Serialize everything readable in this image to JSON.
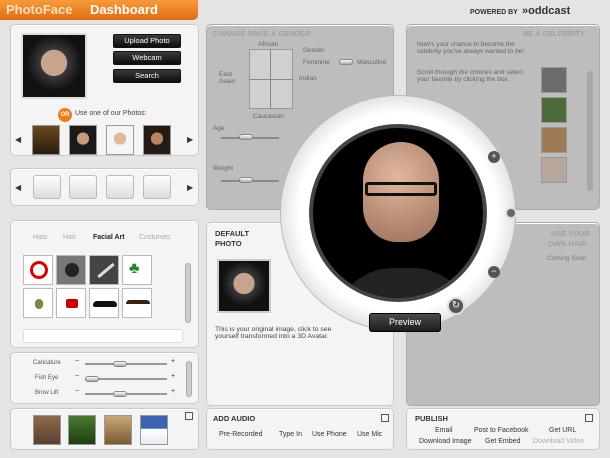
{
  "header": {
    "title_light": "PhotoFace",
    "title_bold": "Dashboard",
    "powered_by": "POWERED BY",
    "brand": "»oddcast"
  },
  "photo_panel": {
    "upload_label": "Upload Photo",
    "webcam_label": "Webcam",
    "search_label": "Search",
    "or_badge": "OR",
    "use_photos_label": "Use one of our Photos:"
  },
  "gender_panel": {
    "title": "CHANGE RACE & GENDER",
    "african": "African",
    "gender": "Gender",
    "east_asian": "East\nAsian",
    "feminine": "Feminine",
    "masculine": "Masculine",
    "indian": "Indian",
    "caucasian": "Caucasian",
    "age": "Age",
    "weight": "Weight"
  },
  "celebrity_panel": {
    "title": "BE A CELEBRITY",
    "text1": "Now's your chance to become the celebrity you've always wanted to be!",
    "text2": "Scroll through the choices and select your favorite by clicking the box."
  },
  "hair_panel": {
    "title_line1": "USE YOUR",
    "title_line2": "OWN HAIR",
    "coming_soon": "Coming Soon"
  },
  "tabs": {
    "hats": "Hats",
    "hair": "Hair",
    "facial_art": "Facial Art",
    "costumes": "Costumes"
  },
  "sliders": {
    "caricature": "Caricature",
    "fish_eye": "Fish Eye",
    "brow_lift": "Brow Lift"
  },
  "default_photo": {
    "title_line1": "DEFAULT",
    "title_line2": "PHOTO",
    "description": "This is your original image, click to see yourself transformed into a 3D Avatar."
  },
  "preview_label": "Preview",
  "add_audio": {
    "title": "ADD AUDIO",
    "pre_recorded": "Pre-Recorded",
    "type_in": "Type In",
    "use_phone": "Use Phone",
    "use_mic": "Use Mic"
  },
  "publish": {
    "title": "PUBLISH",
    "email": "Email",
    "post_facebook": "Post to Facebook",
    "get_url": "Get URL",
    "download_image": "Download Image",
    "get_embed": "Get Embed",
    "download_video": "Download Video"
  },
  "colors": {
    "brand_orange": "#f07d1a",
    "panel_bg": "#f4f4f4",
    "dim_panel": "#bdbdbd"
  },
  "icons": {
    "or_badge": "orange-circle",
    "no_sign": "prohibition-icon",
    "rose": "rose-icon",
    "feather": "feather-icon",
    "clover": "shamrock-icon",
    "thistle": "thistle-icon",
    "dragon": "dragon-icon",
    "mustache": "mustache-icon",
    "mustache2": "handlebar-mustache-icon",
    "expand": "expand-icon",
    "rotate": "rotate-icon"
  }
}
